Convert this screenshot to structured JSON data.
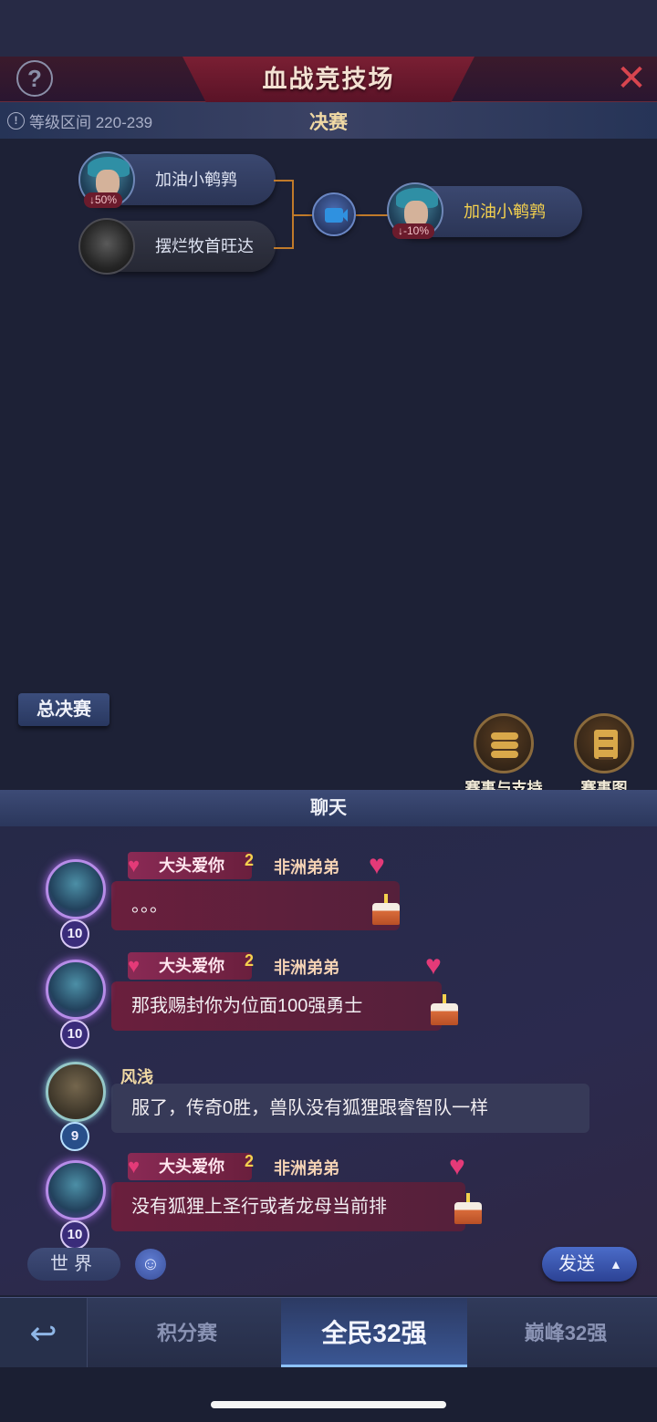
{
  "header": {
    "title": "血战竞技场",
    "help_label": "?",
    "close_label": "✕"
  },
  "subheader": {
    "level_label": "等级区间 220-239",
    "round_title": "决赛"
  },
  "bracket": {
    "players": [
      {
        "name": "加油小鹌鹑",
        "badge": "↓50%"
      },
      {
        "name": "摆烂牧首旺达",
        "badge": ""
      }
    ],
    "winner": {
      "name": "加油小鹌鹑",
      "badge": "↓-10%"
    }
  },
  "final_tab": "总决赛",
  "actions": [
    {
      "label": "赛事与支持",
      "icon": "coins-icon"
    },
    {
      "label": "赛事图",
      "icon": "sheet-icon"
    }
  ],
  "chat": {
    "title": "聊天",
    "messages": [
      {
        "level": "10",
        "title_tag": "大头爱你",
        "title_rank": "2",
        "sender": "非洲弟弟",
        "text": "。。。"
      },
      {
        "level": "10",
        "title_tag": "大头爱你",
        "title_rank": "2",
        "sender": "非洲弟弟",
        "text": "那我赐封你为位面100强勇士"
      },
      {
        "level": "9",
        "sender": "风浅",
        "text": "服了，传奇0胜，兽队没有狐狸跟睿智队一样"
      },
      {
        "level": "10",
        "title_tag": "大头爱你",
        "title_rank": "2",
        "sender": "非洲弟弟",
        "text": "没有狐狸上圣行或者龙母当前排"
      }
    ],
    "channel": "世界",
    "emoji": "☺",
    "input_value": "",
    "send_label": "发送",
    "send_arrow": "▲"
  },
  "nav": {
    "back_icon": "↩",
    "tabs": [
      {
        "label": "积分赛"
      },
      {
        "label": "全民32强"
      },
      {
        "label": "巅峰32强"
      }
    ]
  }
}
